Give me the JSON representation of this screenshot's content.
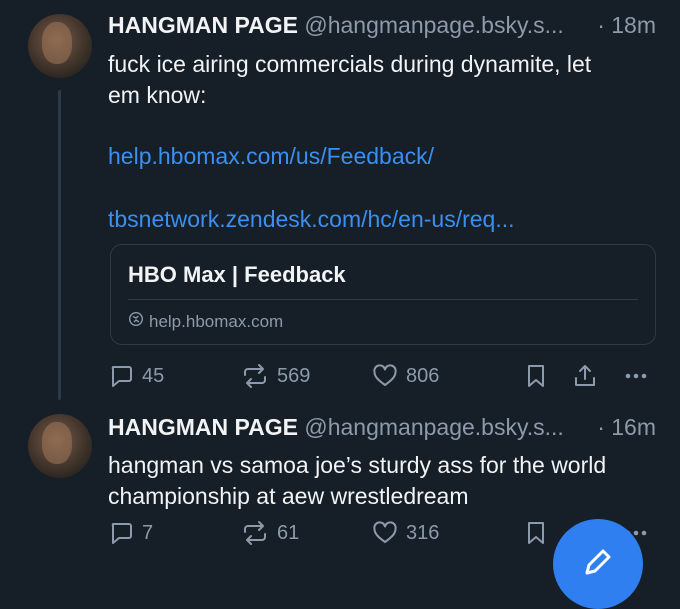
{
  "posts": [
    {
      "author_name": "HANGMAN PAGE",
      "handle": "@hangmanpage.bsky.s...",
      "time": "· 18m",
      "text_lines": [
        "fuck ice airing commercials during dynamite, let",
        "em know:"
      ],
      "links": [
        "help.hbomax.com/us/Feedback/",
        "tbsnetwork.zendesk.com/hc/en-us/req..."
      ],
      "card": {
        "title": "HBO Max | Feedback",
        "domain": "help.hbomax.com"
      },
      "replies": "45",
      "reposts": "569",
      "likes": "806"
    },
    {
      "author_name": "HANGMAN PAGE",
      "handle": "@hangmanpage.bsky.s...",
      "time": "· 16m",
      "text_lines": [
        "hangman vs samoa joe’s sturdy ass for the world",
        "championship at aew wrestledream"
      ],
      "replies": "7",
      "reposts": "61",
      "likes": "316"
    }
  ],
  "colors": {
    "background": "#161e27",
    "accent": "#3b8ff0",
    "muted": "#8c9aab"
  },
  "icons": [
    "reply-icon",
    "repost-icon",
    "like-icon",
    "bookmark-icon",
    "share-icon",
    "more-icon",
    "globe-icon",
    "compose-icon"
  ]
}
